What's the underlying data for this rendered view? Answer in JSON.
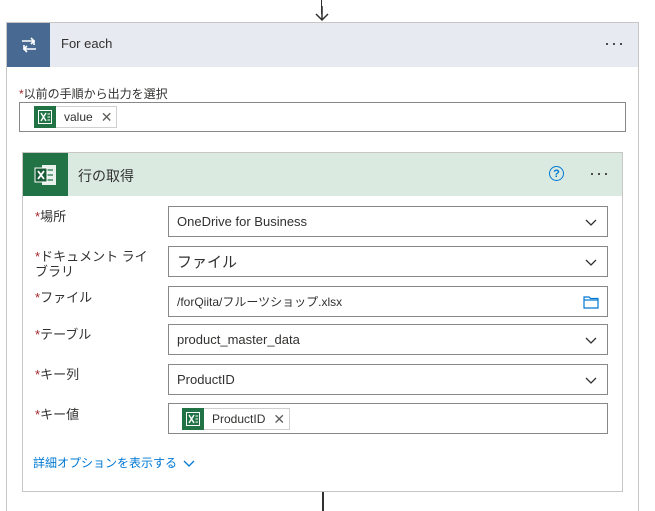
{
  "foreach": {
    "title": "For each",
    "more_label": "···",
    "prev_output_label": "以前の手順から出力を選択",
    "prev_output_token": "value"
  },
  "action": {
    "title": "行の取得",
    "help_label": "?",
    "more_label": "···",
    "fields": {
      "location": {
        "label": "場所",
        "value": "OneDrive for Business"
      },
      "doc_library": {
        "label": "ドキュメント ライブラリ",
        "value": "ファイル"
      },
      "file": {
        "label": "ファイル",
        "value": "/forQiita/フルーツショップ.xlsx"
      },
      "table": {
        "label": "テーブル",
        "value": "product_master_data"
      },
      "key_column": {
        "label": "キー列",
        "value": "ProductID"
      },
      "key_value": {
        "label": "キー値",
        "token": "ProductID"
      }
    },
    "advanced_link": "詳細オプションを表示する"
  },
  "required_marker": "*",
  "token_close": "✕",
  "colors": {
    "foreach_accent": "#486991",
    "excel_green": "#217346",
    "link_blue": "#0078d4",
    "required_red": "#a4262c"
  }
}
